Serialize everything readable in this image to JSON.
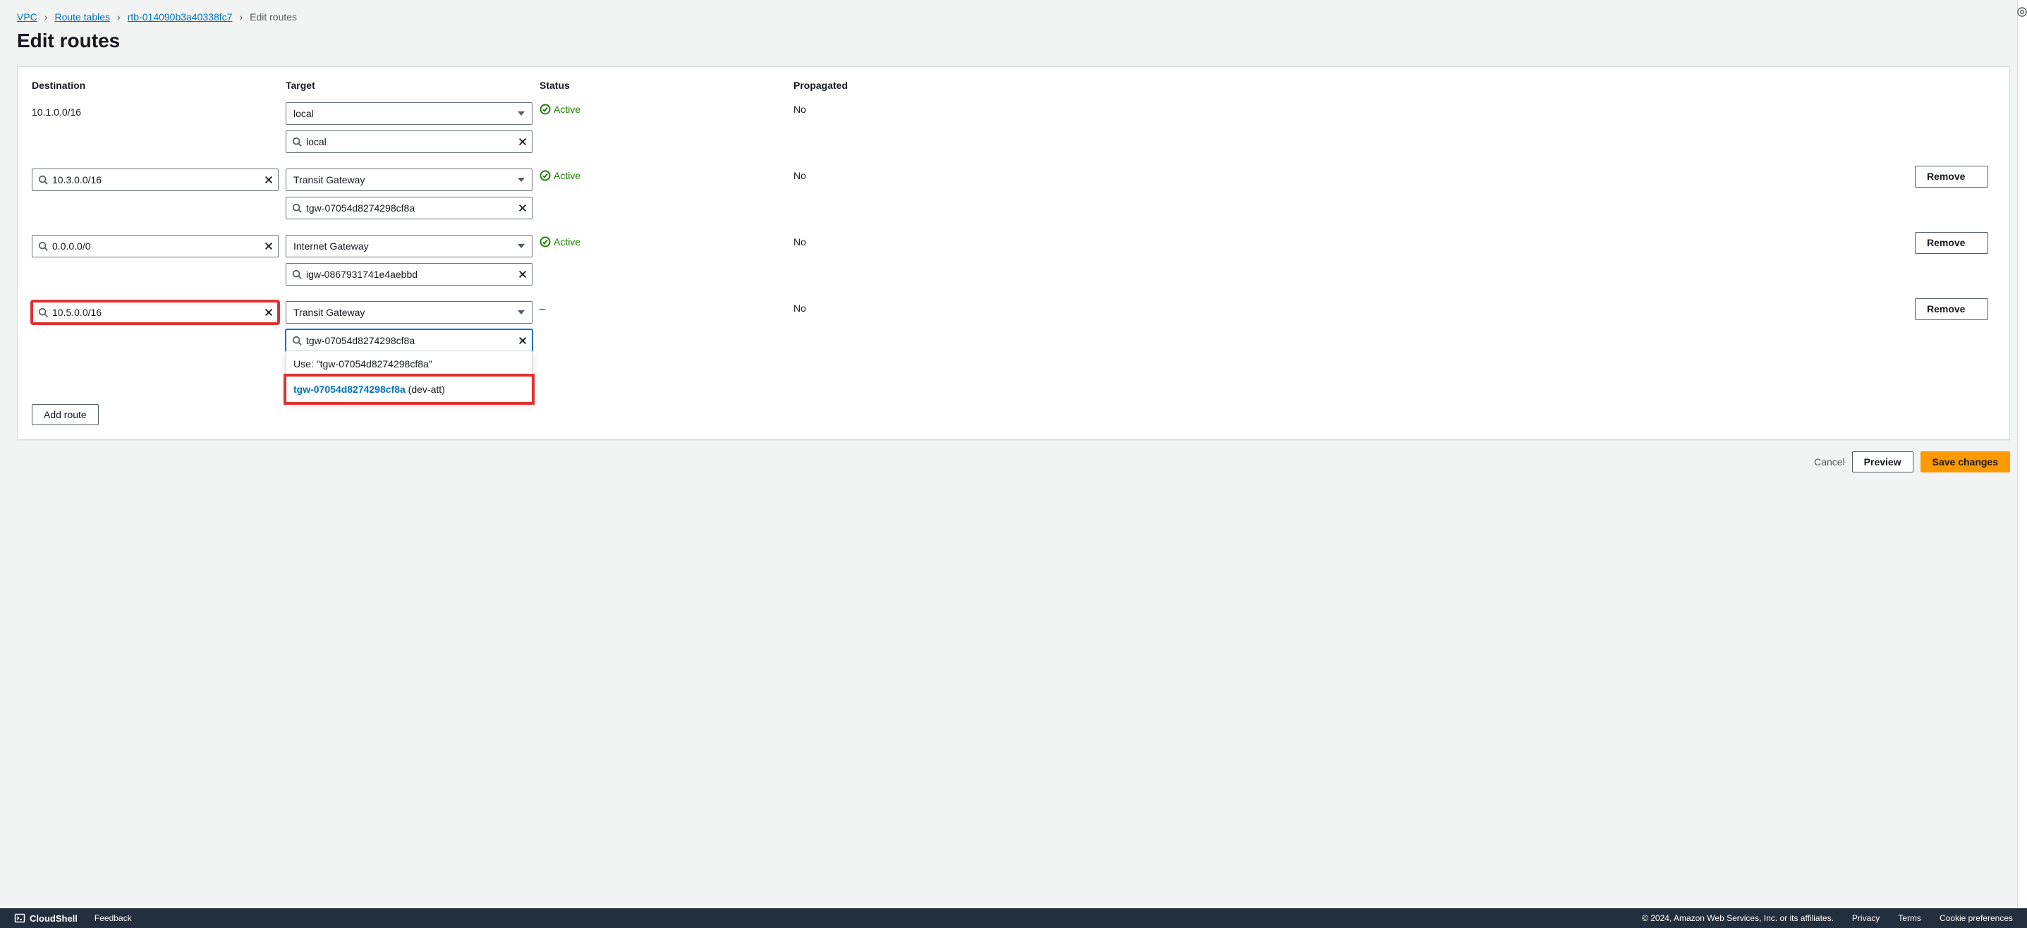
{
  "breadcrumbs": {
    "vpc": "VPC",
    "route_tables": "Route tables",
    "rtb": "rtb-014090b3a40338fc7",
    "current": "Edit routes"
  },
  "page_title": "Edit routes",
  "columns": {
    "destination": "Destination",
    "target": "Target",
    "status": "Status",
    "propagated": "Propagated"
  },
  "routes": [
    {
      "destination_static": "10.1.0.0/16",
      "target_select": "local",
      "target_search": "local",
      "status": "Active",
      "propagated": "No",
      "removable": false
    },
    {
      "destination_input": "10.3.0.0/16",
      "target_select": "Transit Gateway",
      "target_search": "tgw-07054d8274298cf8a",
      "status": "Active",
      "propagated": "No",
      "removable": true
    },
    {
      "destination_input": "0.0.0.0/0",
      "target_select": "Internet Gateway",
      "target_search": "igw-0867931741e4aebbd",
      "status": "Active",
      "propagated": "No",
      "removable": true
    },
    {
      "destination_input": "10.5.0.0/16",
      "target_select": "Transit Gateway",
      "target_search": "tgw-07054d8274298cf8a",
      "status_dash": "–",
      "propagated": "No",
      "removable": true,
      "dest_highlight": true,
      "search_focused": true
    }
  ],
  "dropdown": {
    "use_prefix": "Use: ",
    "use_value": "\"tgw-07054d8274298cf8a\"",
    "match_id": "tgw-07054d8274298cf8a",
    "match_alias": " (dev-att)"
  },
  "buttons": {
    "remove": "Remove",
    "add_route": "Add route",
    "cancel": "Cancel",
    "preview": "Preview",
    "save": "Save changes"
  },
  "footer": {
    "cloudshell": "CloudShell",
    "feedback": "Feedback",
    "copyright": "© 2024, Amazon Web Services, Inc. or its affiliates.",
    "privacy": "Privacy",
    "terms": "Terms",
    "cookies": "Cookie preferences"
  }
}
